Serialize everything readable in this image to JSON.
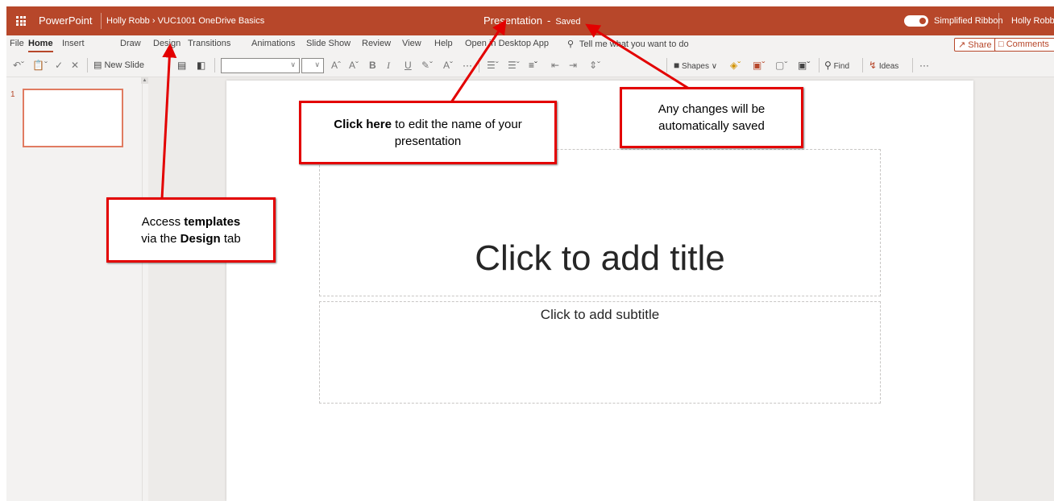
{
  "titlebar": {
    "app_name": "PowerPoint",
    "breadcrumb": "Holly Robb › VUC1001 OneDrive Basics",
    "presentation_name": "Presentation",
    "dash": "-",
    "save_status": "Saved",
    "simplified_ribbon_label": "Simplified Ribbon",
    "simplified_ribbon_on": true,
    "user_name": "Holly Robb"
  },
  "tabs": {
    "file": "File",
    "home": "Home",
    "insert": "Insert",
    "draw": "Draw",
    "design": "Design",
    "transitions": "Transitions",
    "animations": "Animations",
    "slide_show": "Slide Show",
    "review": "Review",
    "view": "View",
    "help": "Help",
    "open_desktop": "Open in Desktop App",
    "tell_me": "Tell me what you want to do",
    "share": "Share",
    "comments": "Comments"
  },
  "ribbon": {
    "new_slide": "New Slide",
    "shapes": "Shapes",
    "find": "Find",
    "ideas": "Ideas",
    "more": "···",
    "font_name": "",
    "font_size": ""
  },
  "thumbnails": {
    "slide_number": "1"
  },
  "slide": {
    "title_placeholder": "Click to add title",
    "subtitle_placeholder": "Click to add subtitle"
  },
  "callouts": {
    "rename": {
      "bold": "Click here",
      "rest": " to edit the name of your presentation"
    },
    "autosave": {
      "text": "Any changes will be automatically saved"
    },
    "templates": {
      "part1": "Access ",
      "bold1": "templates",
      "part2": "via the ",
      "bold2": "Design",
      "part3": " tab"
    }
  },
  "colors": {
    "brand": "#b7472a",
    "callout_border": "#e30000",
    "arrow": "#e30000",
    "thumb_border": "#e07b61"
  }
}
